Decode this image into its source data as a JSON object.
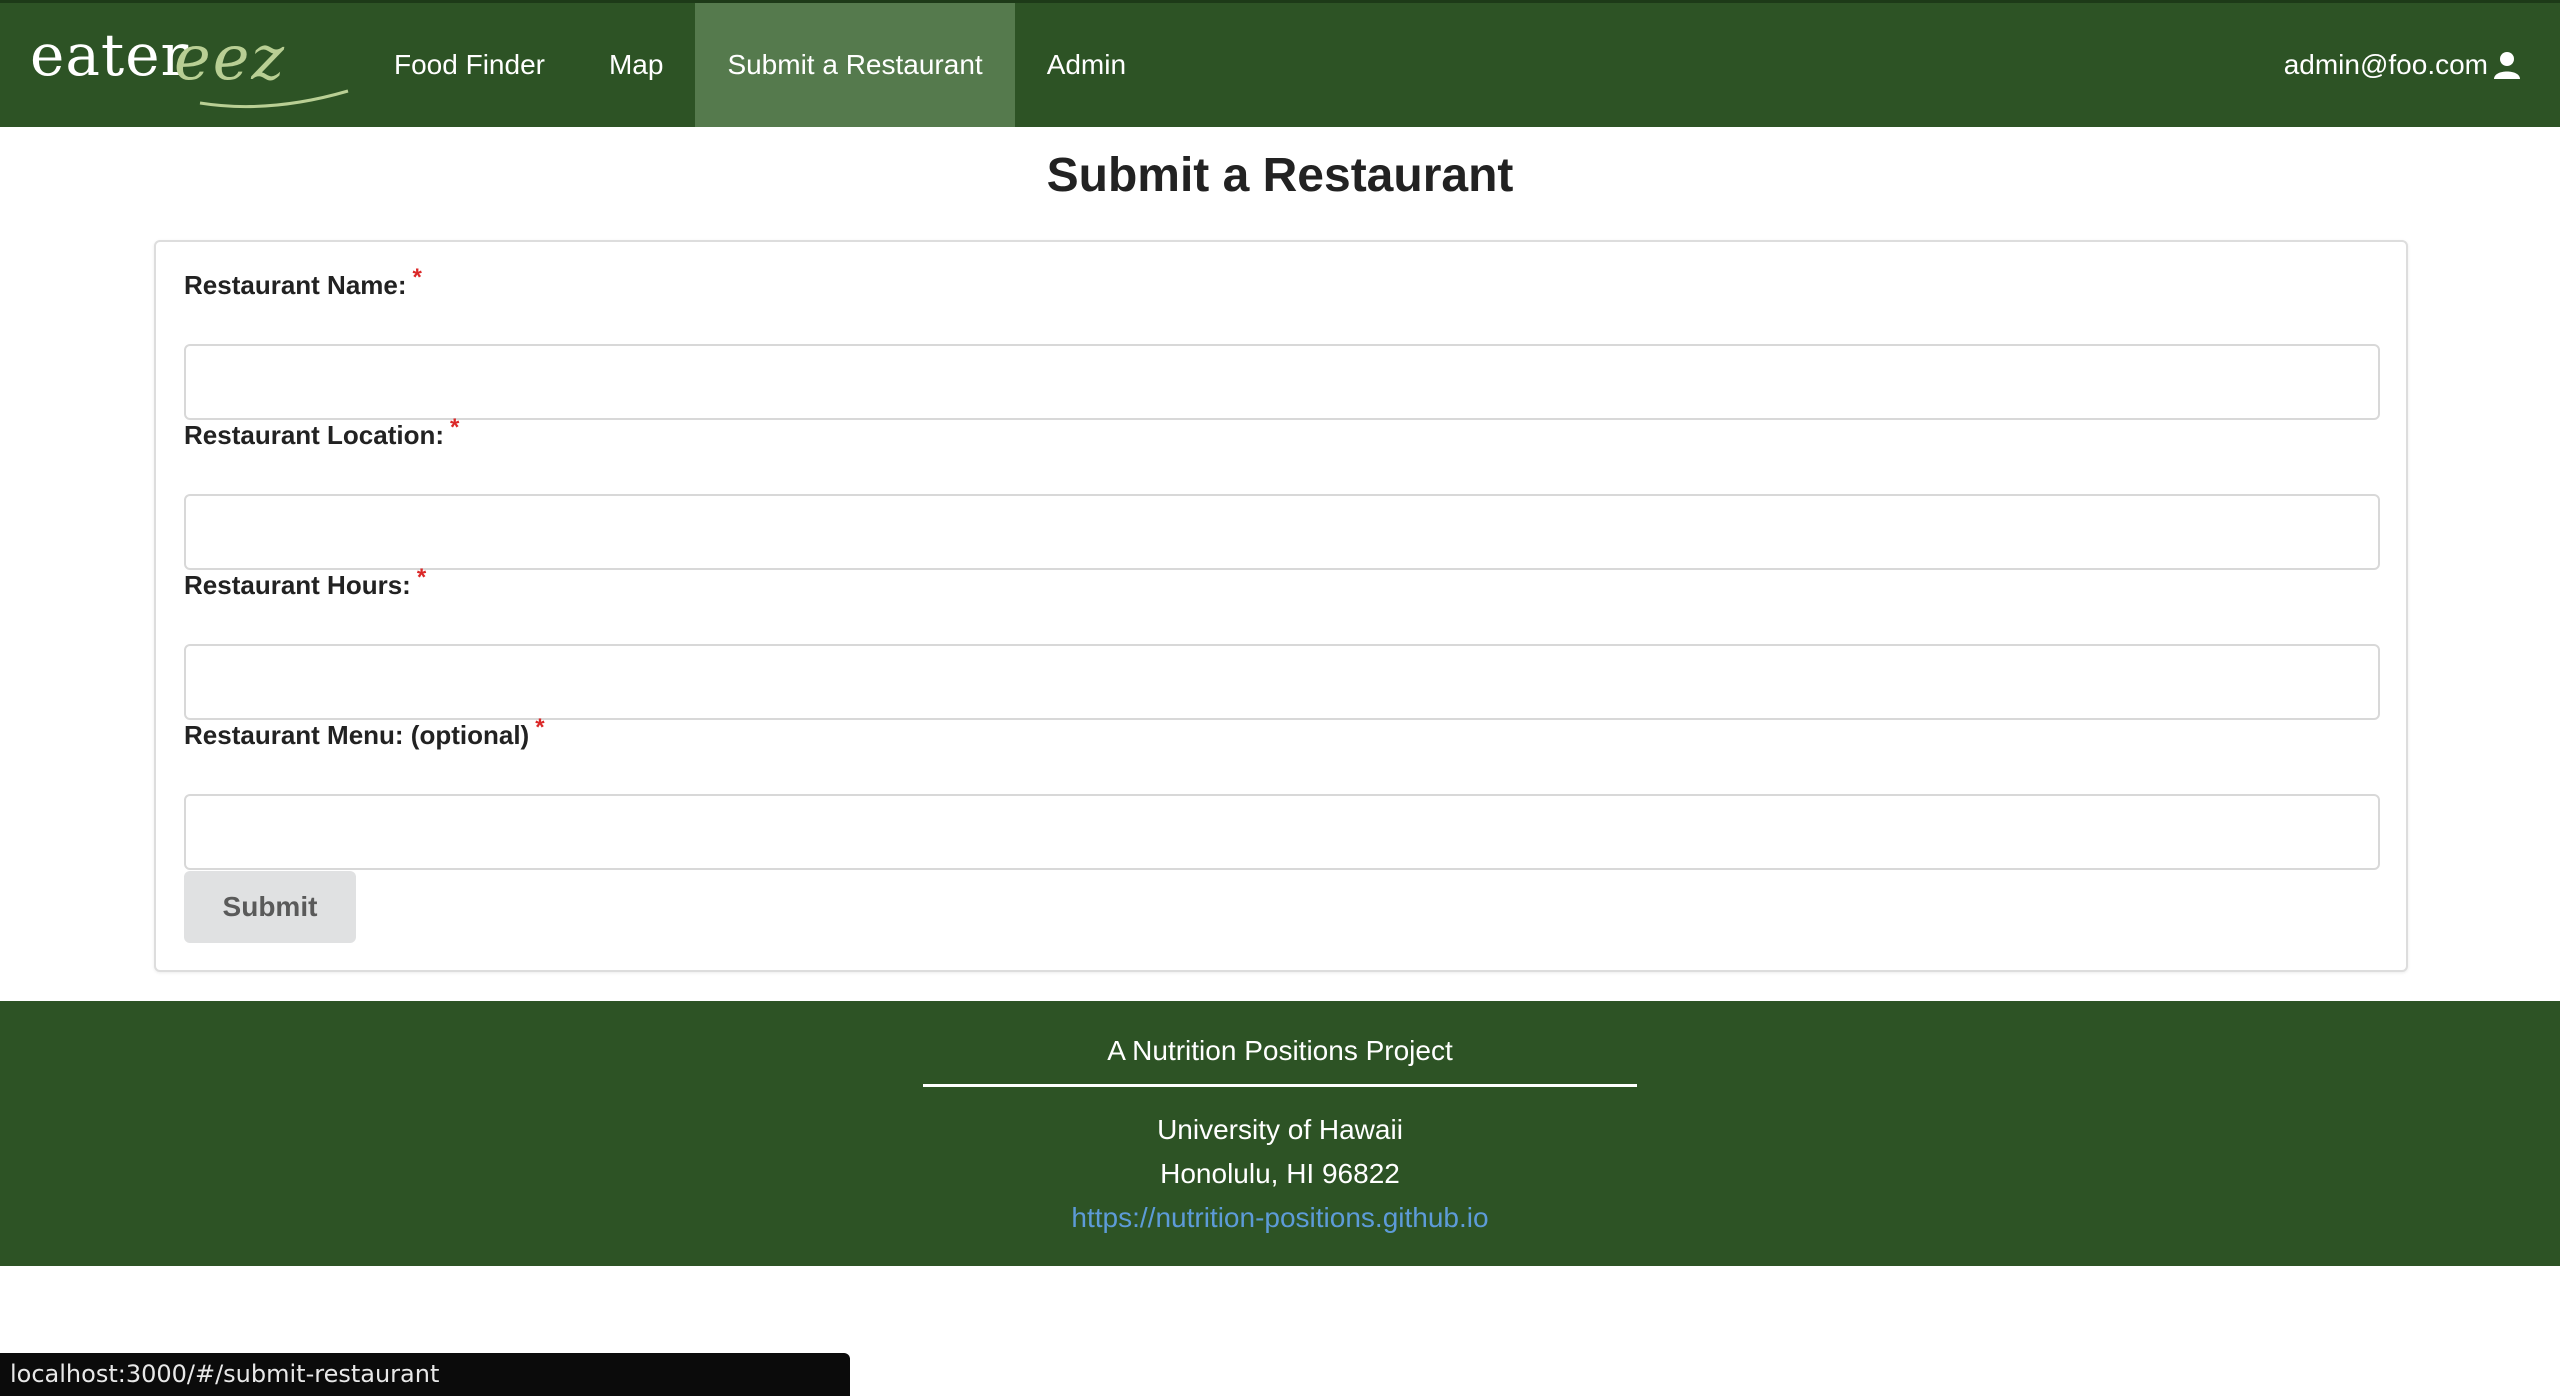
{
  "brand": {
    "word": "eater",
    "script": "eez"
  },
  "nav": {
    "items": [
      {
        "label": "Food Finder"
      },
      {
        "label": "Map"
      },
      {
        "label": "Submit a Restaurant"
      },
      {
        "label": "Admin"
      }
    ],
    "active_index": 2,
    "user_email": "admin@foo.com",
    "user_icon": "user-icon"
  },
  "page": {
    "title": "Submit a Restaurant"
  },
  "form": {
    "fields": [
      {
        "label": "Restaurant Name:",
        "required_mark": "*",
        "value": "",
        "placeholder": ""
      },
      {
        "label": "Restaurant Location:",
        "required_mark": "*",
        "value": "",
        "placeholder": ""
      },
      {
        "label": "Restaurant Hours:",
        "required_mark": "*",
        "value": "",
        "placeholder": ""
      },
      {
        "label": "Restaurant Menu: (optional)",
        "required_mark": "*",
        "value": "",
        "placeholder": ""
      }
    ],
    "submit_label": "Submit"
  },
  "footer": {
    "project": "A Nutrition Positions Project",
    "org": "University of Hawaii",
    "address": "Honolulu, HI 96822",
    "link": "https://nutrition-positions.github.io"
  },
  "status_bar": {
    "url": "localhost:3000/#/submit-restaurant"
  },
  "colors": {
    "nav_bg": "#2d5325",
    "nav_active_bg": "#557a4d",
    "required": "#db2828",
    "link": "#5d9bd8",
    "button_bg": "#e0e1e2"
  }
}
